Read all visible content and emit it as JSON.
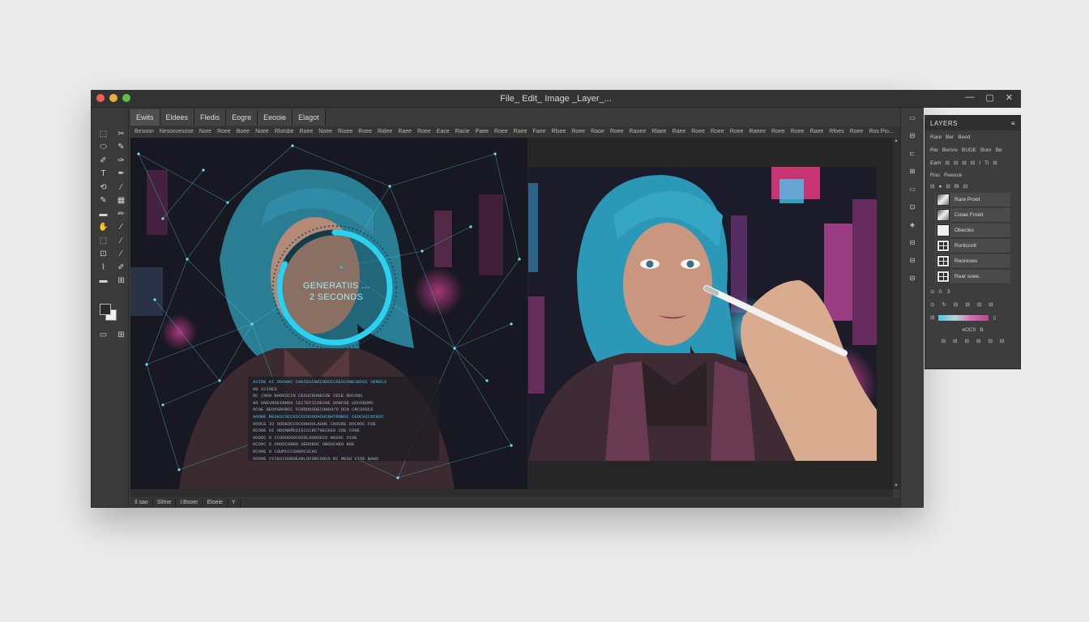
{
  "app": {
    "title": "File_ Edit_ Image _Layer_..."
  },
  "window_controls": [
    "—",
    "▢",
    "✕"
  ],
  "toolbox": {
    "tools": [
      "⬚",
      "✂",
      "⬭",
      "✎",
      "✐",
      "✑",
      "T",
      "✒",
      "⟲",
      "⁄",
      "✎",
      "▦",
      "▬",
      "✏",
      "✋",
      "⁄",
      "⬚",
      "⁄",
      "⊡",
      "⁄",
      "⌇",
      "✐",
      "▬",
      "⊞"
    ],
    "foreground_color": "#2a2a2a",
    "background_color": "#f0f0f0",
    "bottom": [
      "▭",
      "⊞"
    ]
  },
  "tabs": [
    "Ewits",
    "Eldees",
    "Fledis",
    "Eogre",
    "Eeooie",
    "Elagot"
  ],
  "options_bar": [
    "Besoon",
    "Nesosvesose",
    "Nore",
    "Roee",
    "Boee",
    "Noee",
    "Rlotsbe",
    "Roee",
    "Noee",
    "Rioee",
    "Roee",
    "Ridee",
    "Raee",
    "Roee",
    "Eace",
    "Racie",
    "Paee",
    "Roee",
    "Raee",
    "Faee",
    "Rlsee",
    "Roee",
    "Raoe",
    "Roee",
    "Raoee",
    "Rlaee",
    "Raee",
    "Roee",
    "Roee",
    "Roee",
    "Raeee",
    "Roee",
    "Roee",
    "Raee",
    "Rfoes",
    "Roee",
    "Ros Pio..."
  ],
  "generation": {
    "line1": "GENERATIIS ...",
    "line2": "2 SECONDS",
    "progress_pct": 82
  },
  "log": {
    "lines": [
      {
        "text": "AVIOE AI  DOOHAC CHECESCNECODOCCEESCONESEDOC VERDCS",
        "hi": true
      },
      {
        "text": "00  1CIOES",
        "hi": false
      },
      {
        "text": "OC  (NO0 BAOEOCIN CECUCRUNECOE CECE RUCONS",
        "hi": false
      },
      {
        "text": "AO  ONEVROEIRN00 CECTEFICOECHE DONCOE UOCOBOMS",
        "hi": false
      },
      {
        "text": "OCOE  REOOSRORCC FCRDOOSDECOHOO/O OCN CRCSOSCS",
        "hi": false
      },
      {
        "text": "AOOBE  REOKSCOCCEDCOCOOOOAOUCBHTRNBOC CEOCHICOCEOC",
        "hi": true
      },
      {
        "text": "OOOCE  IO OODEOCCOCOOHOOLAOHE CNOCRE DOCROC FOE",
        "hi": false
      },
      {
        "text": "OCOOE  OI ODONROCOIECCCRCTNECEEO COE CONE",
        "hi": false
      },
      {
        "text": "OOOOC  O CCOOOOOOCOOOLOOOOECO NOOOC  OIOE",
        "hi": false
      },
      {
        "text": "OCOOC  O OOOOCOBRO OEDOROC OBOUCHEO   RDE",
        "hi": false
      },
      {
        "text": "OCOOE  O COUMCCCSHOOCSCAS",
        "hi": false
      },
      {
        "text": "OOOOE  VICEOIDOBOEARLOFORCOOCO RC MEOU VIOE BAHS",
        "hi": false
      }
    ]
  },
  "status_bar": [
    "Il  sao",
    "Slitne",
    "I:Bsoer",
    "Eloeie",
    "Y"
  ],
  "side_strip": [
    "▭",
    "⊟",
    "⊏",
    "⊞",
    "▭",
    "⊡",
    "◈",
    "⊟",
    "⊟",
    "⊟"
  ],
  "layers_panel": {
    "title": "LAYERS",
    "row1": [
      "Rare",
      "Ber",
      "Beed"
    ],
    "row2": [
      "Rie",
      "Bersre",
      "BUDE",
      "Boor",
      "Be"
    ],
    "row3": [
      "Eam",
      "⊟",
      "⊟",
      "⊟",
      "⊟",
      "I",
      "Ti",
      "⊟"
    ],
    "row4": [
      "Roo",
      "Reeoce"
    ],
    "row5": [
      "⊟",
      "●",
      "⊟",
      "Bl",
      "⊟"
    ],
    "layers": [
      {
        "name": "Rare Proet",
        "thumb": "img"
      },
      {
        "name": "Colae Froelt",
        "thumb": "img"
      },
      {
        "name": "Obecles",
        "thumb": "plain"
      },
      {
        "name": "Rorticoclt",
        "thumb": "grid"
      },
      {
        "name": "Reoreoes",
        "thumb": "grid"
      },
      {
        "name": "Rear soee.",
        "thumb": "grid"
      }
    ],
    "opacity_label": "0.",
    "opacity_value": "3",
    "icons_row": [
      "⊙",
      "↻",
      "⊟",
      "⊟",
      "⊟",
      "⊟"
    ],
    "gradient_label": "⊟",
    "bottom_label": "eOC0",
    "bottom_value": "B",
    "bottom_icons": [
      "⊟",
      "⊟",
      "⊟",
      "⊟",
      "⊟",
      "⊟"
    ]
  }
}
